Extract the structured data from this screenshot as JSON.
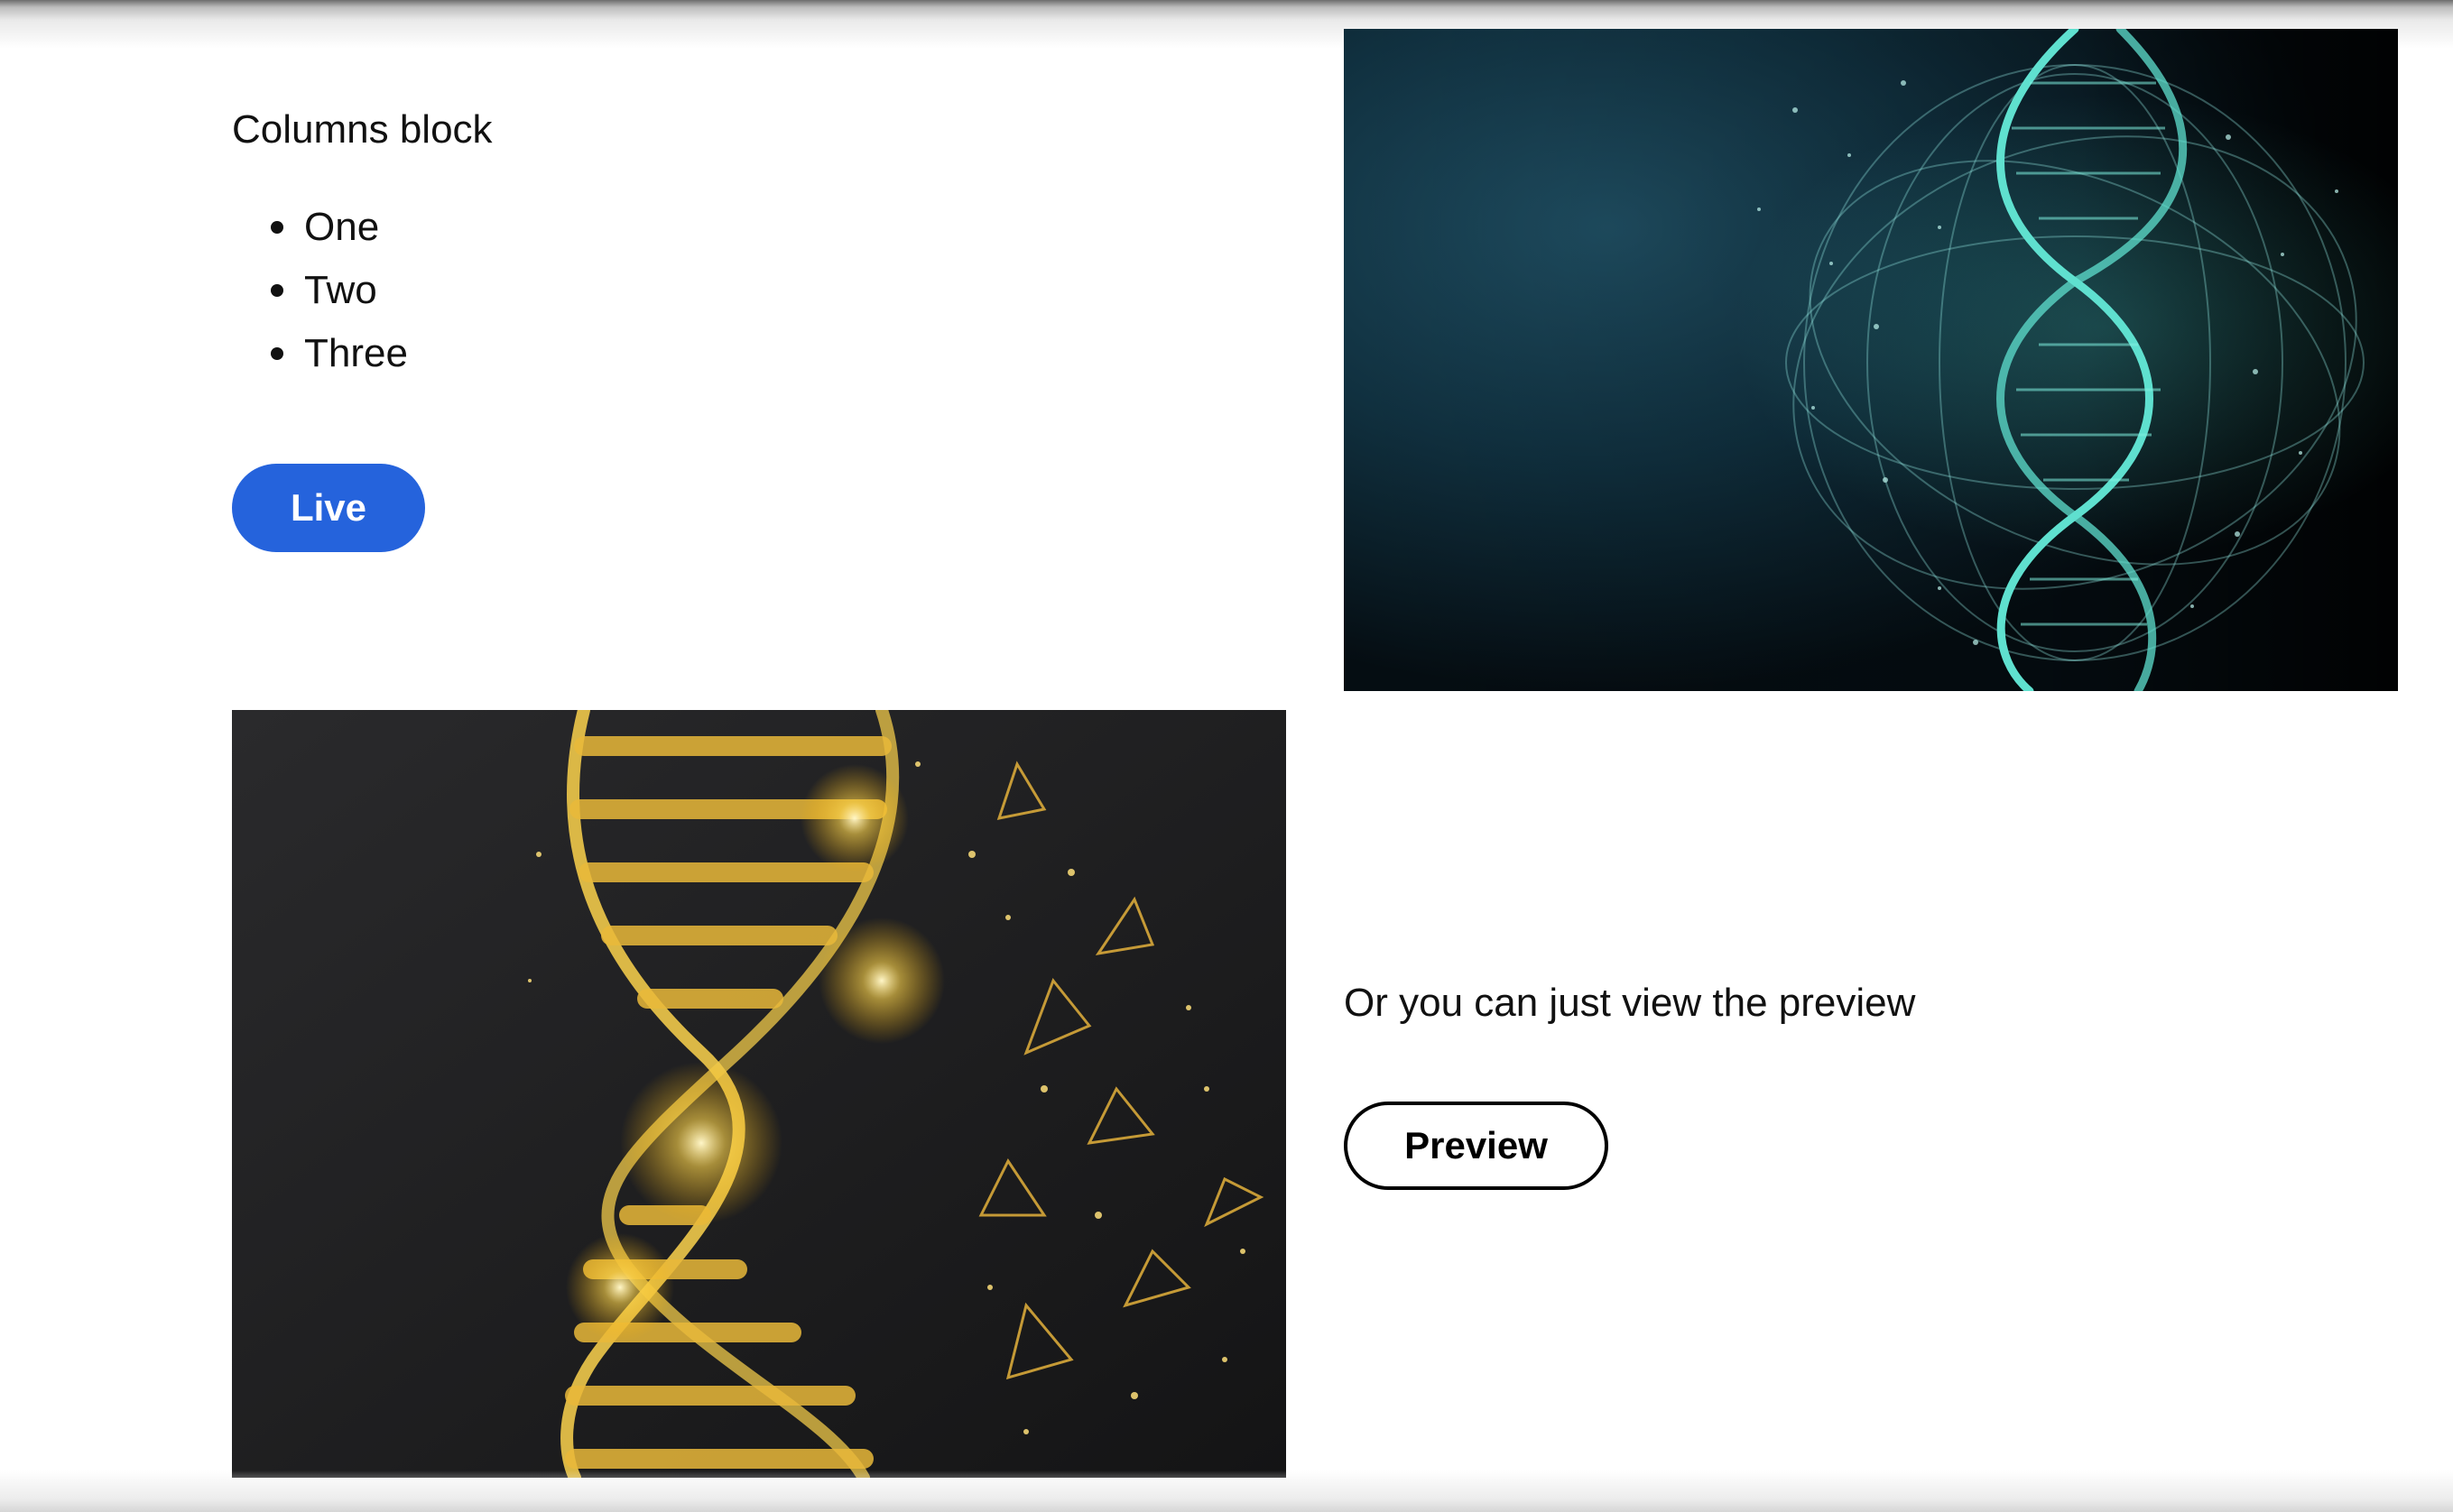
{
  "columns_top": {
    "heading": "Columns block",
    "list_items": [
      "One",
      "Two",
      "Three"
    ],
    "live_button_label": "Live",
    "live_button_color": "#2563dc",
    "image": {
      "description_icon": "dna-teal-image"
    }
  },
  "columns_bottom": {
    "image": {
      "description_icon": "dna-gold-image"
    },
    "text": "Or you can just view the preview",
    "preview_button_label": "Preview"
  }
}
